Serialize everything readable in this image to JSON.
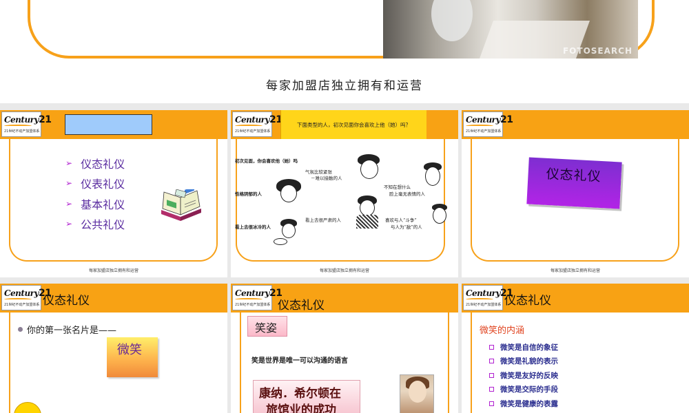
{
  "top": {
    "watermark": "FOTOSEARCH",
    "footer": "每家加盟店独立拥有和运营"
  },
  "logo": {
    "brand": "Century",
    "number": "21",
    "tagline": "21世纪不动产加盟体系"
  },
  "slide_footer": "每家加盟店独立拥有和运营",
  "slide1": {
    "items": [
      "仪态礼仪",
      "仪表礼仪",
      "基本礼仪",
      "公共礼仪"
    ]
  },
  "slide2": {
    "question": "下面类型的人，初次见面你会喜欢上他（她）吗？",
    "labels": {
      "intro": "初次见面，你会喜欢他（她）吗",
      "gloomy": "性格阴郁的人",
      "cold": "看上去很冰冷的人",
      "tense": "气氛比较紧张",
      "hard": "－难以接触的人",
      "unknown1": "不知在想什么",
      "unknown2": "脸上毫无表情的人",
      "serious": "看上去很严肃的人",
      "fight1": "喜欢与人“斗争”",
      "fight2": "与人为“敌”的人"
    }
  },
  "slide3": {
    "card": "仪态礼仪"
  },
  "slide4": {
    "title": "仪态礼仪",
    "first_card": "你的第一张名片是——",
    "smile": "微笑"
  },
  "slide5": {
    "title": "仪态礼仪",
    "tag": "笑姿",
    "line": "笑是世界是唯一可以沟通的语言",
    "box_line1": "康纳．希尔顿在",
    "box_line2": "旅馆业的成功"
  },
  "slide6": {
    "title": "仪态礼仪",
    "subtitle": "微笑的内涵",
    "items": [
      "微笑是自信的象征",
      "微笑是礼貌的表示",
      "微笑是友好的反映",
      "微笑是交际的手段",
      "微笑是健康的表露"
    ]
  }
}
